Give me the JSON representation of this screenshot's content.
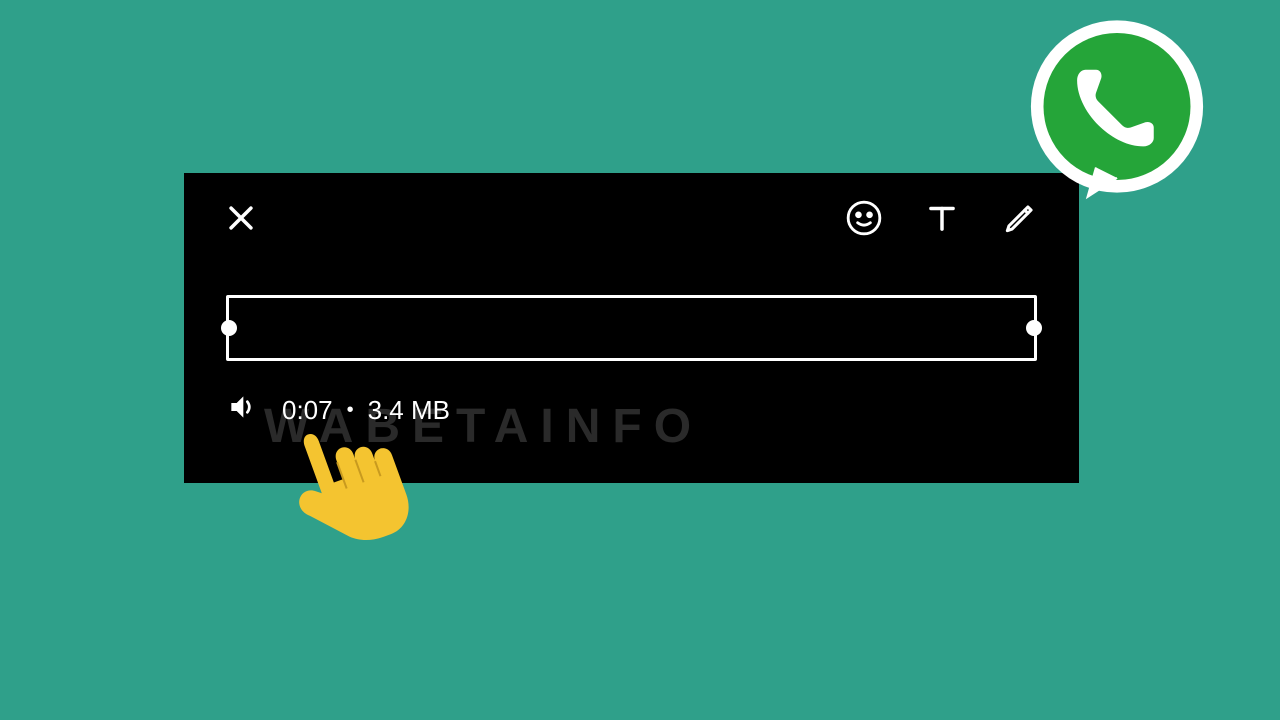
{
  "duration": "0:07",
  "filesize": "3.4 MB",
  "watermark": "WABETAINFO",
  "icons": {
    "close": "close-icon",
    "emoji": "emoji-icon",
    "text": "text-tool-icon",
    "pencil": "pencil-icon",
    "speaker": "speaker-icon"
  }
}
